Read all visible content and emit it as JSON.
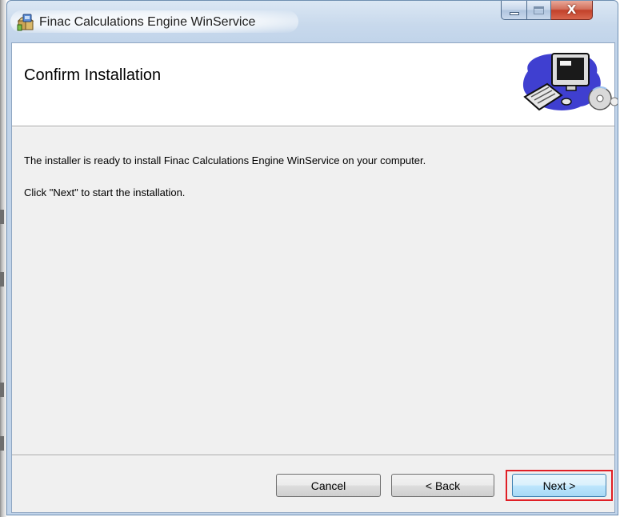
{
  "window": {
    "title": "Finac Calculations Engine WinService",
    "controls": {
      "minimize_icon": "minimize-icon",
      "maximize_icon": "maximize-icon",
      "close_icon": "close-icon",
      "close_glyph": "X"
    }
  },
  "banner": {
    "title": "Confirm Installation",
    "image_icon": "computer-setup-icon"
  },
  "body": {
    "line1": "The installer is ready to install Finac Calculations Engine WinService on your computer.",
    "line2": "Click \"Next\" to start the installation."
  },
  "buttons": {
    "cancel": "Cancel",
    "back": "< Back",
    "next": "Next >"
  },
  "colors": {
    "highlight": "#e01f26",
    "close_button": "#c2412a",
    "titlebar": "#c8d9ec"
  }
}
